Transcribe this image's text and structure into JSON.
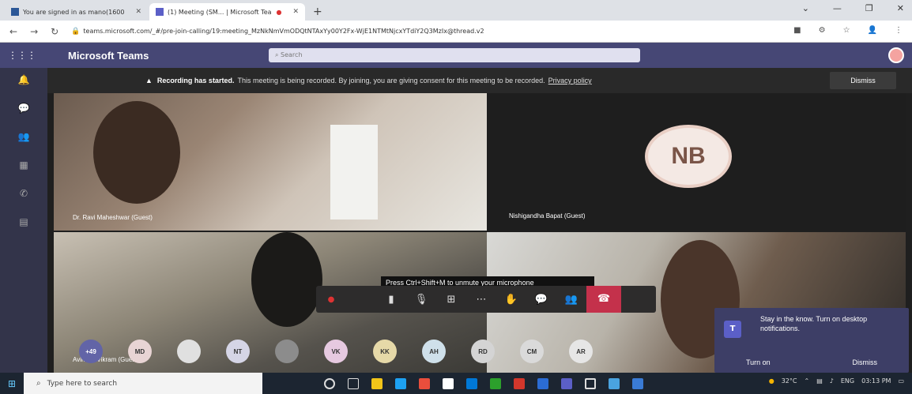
{
  "browser": {
    "tabs": [
      {
        "title": "You are signed in as mano(1600"
      },
      {
        "title": "(1) Meeting (SM... | Microsoft Tea"
      }
    ],
    "new_tab": "+",
    "url": "teams.microsoft.com/_#/pre-join-calling/19:meeting_MzNkNmVmODQtNTAxYy00Y2Fx-WjE1NTMtNjcxYTdiY2Q3MzIx@thread.v2"
  },
  "teams": {
    "app_title": "Microsoft Teams",
    "search_placeholder": "Search"
  },
  "banner": {
    "bold": "Recording has started.",
    "text": "This meeting is being recorded. By joining, you are giving consent for this meeting to be recorded.",
    "link": "Privacy policy",
    "dismiss": "Dismiss"
  },
  "participants": {
    "tile1": "Dr. Ravi Maheshwar (Guest)",
    "tile2_initials": "NB",
    "tile2": "Nishigandha Bapat (Guest)",
    "tile3": "Avinash Vikram (Guest)"
  },
  "tooltip": "Press Ctrl+Shift+M to unmute your microphone",
  "roster": [
    "+49",
    "MD",
    "",
    "NT",
    "",
    "VK",
    "KK",
    "AH",
    "RD",
    "CM",
    "AR"
  ],
  "toast": {
    "icon": "T",
    "message": "Stay in the know. Turn on desktop notifications.",
    "turn_on": "Turn on",
    "dismiss": "Dismiss"
  },
  "taskbar": {
    "search_placeholder": "Type here to search",
    "lang": "ENG",
    "temp": "32°C",
    "time": "03:13 PM"
  }
}
